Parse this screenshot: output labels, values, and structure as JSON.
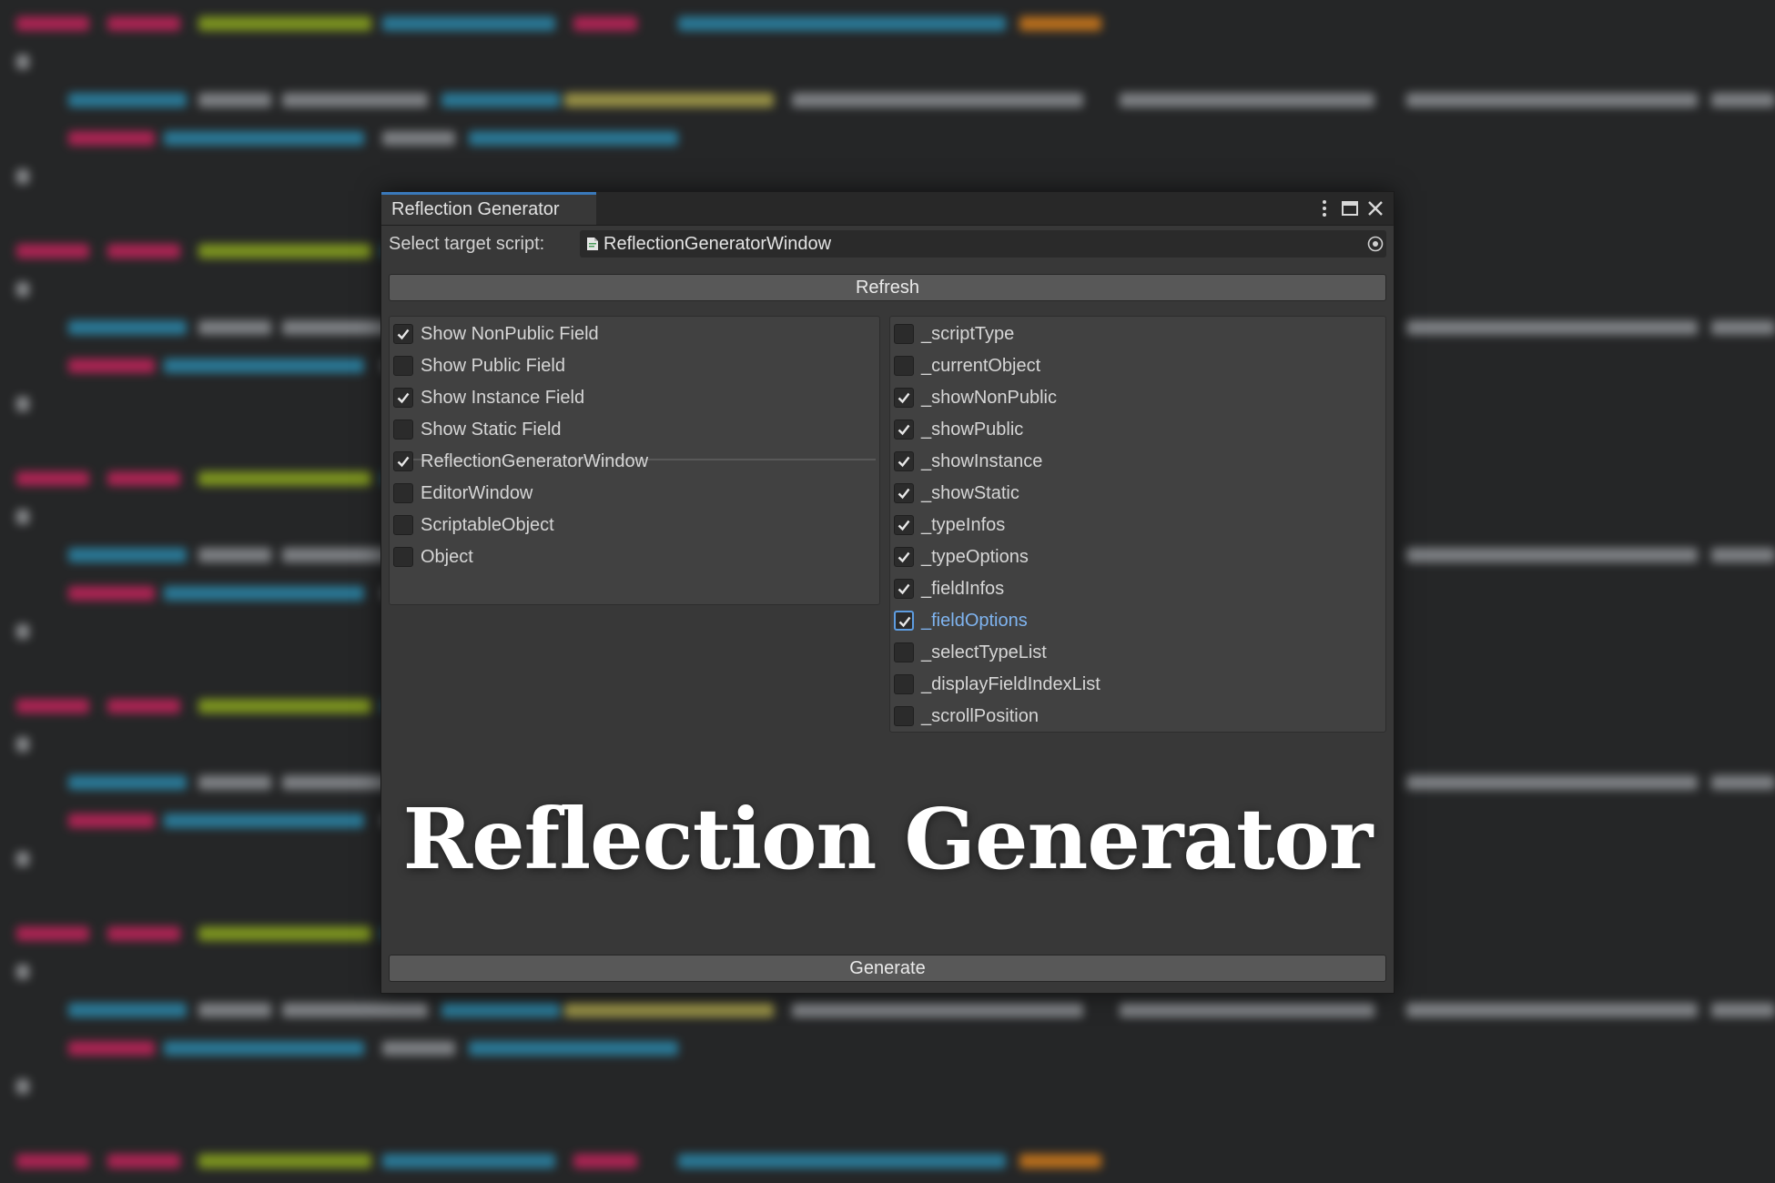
{
  "window": {
    "tab_title": "Reflection Generator",
    "select_target_label": "Select target script:",
    "target_script": "ReflectionGeneratorWindow",
    "refresh_label": "Refresh",
    "generate_label": "Generate"
  },
  "left_options": [
    {
      "label": "Show NonPublic Field",
      "checked": true
    },
    {
      "label": "Show Public Field",
      "checked": false
    },
    {
      "label": "Show Instance Field",
      "checked": true
    },
    {
      "label": "Show Static Field",
      "checked": false
    }
  ],
  "type_options": [
    {
      "label": "ReflectionGeneratorWindow",
      "checked": true
    },
    {
      "label": "EditorWindow",
      "checked": false
    },
    {
      "label": "ScriptableObject",
      "checked": false
    },
    {
      "label": "Object",
      "checked": false
    }
  ],
  "field_options": [
    {
      "label": "_scriptType",
      "checked": false
    },
    {
      "label": "_currentObject",
      "checked": false
    },
    {
      "label": "_showNonPublic",
      "checked": true
    },
    {
      "label": "_showPublic",
      "checked": true
    },
    {
      "label": "_showInstance",
      "checked": true
    },
    {
      "label": "_showStatic",
      "checked": true
    },
    {
      "label": "_typeInfos",
      "checked": true
    },
    {
      "label": "_typeOptions",
      "checked": true
    },
    {
      "label": "_fieldInfos",
      "checked": true
    },
    {
      "label": "_fieldOptions",
      "checked": true,
      "focused": true
    },
    {
      "label": "_selectTypeList",
      "checked": false
    },
    {
      "label": "_displayFieldIndexList",
      "checked": false
    },
    {
      "label": "_scrollPosition",
      "checked": false
    }
  ],
  "overlay_title": "Reflection Generator",
  "colors": {
    "accent": "#3a79bb",
    "focus_text": "#7fb4f0",
    "window_bg": "#383838",
    "button_bg": "#585858"
  },
  "icons": {
    "more": "more-vertical-icon",
    "maximize": "maximize-icon",
    "close": "close-icon",
    "script": "script-file-icon",
    "picker": "object-picker-icon",
    "check": "checkmark-icon"
  }
}
